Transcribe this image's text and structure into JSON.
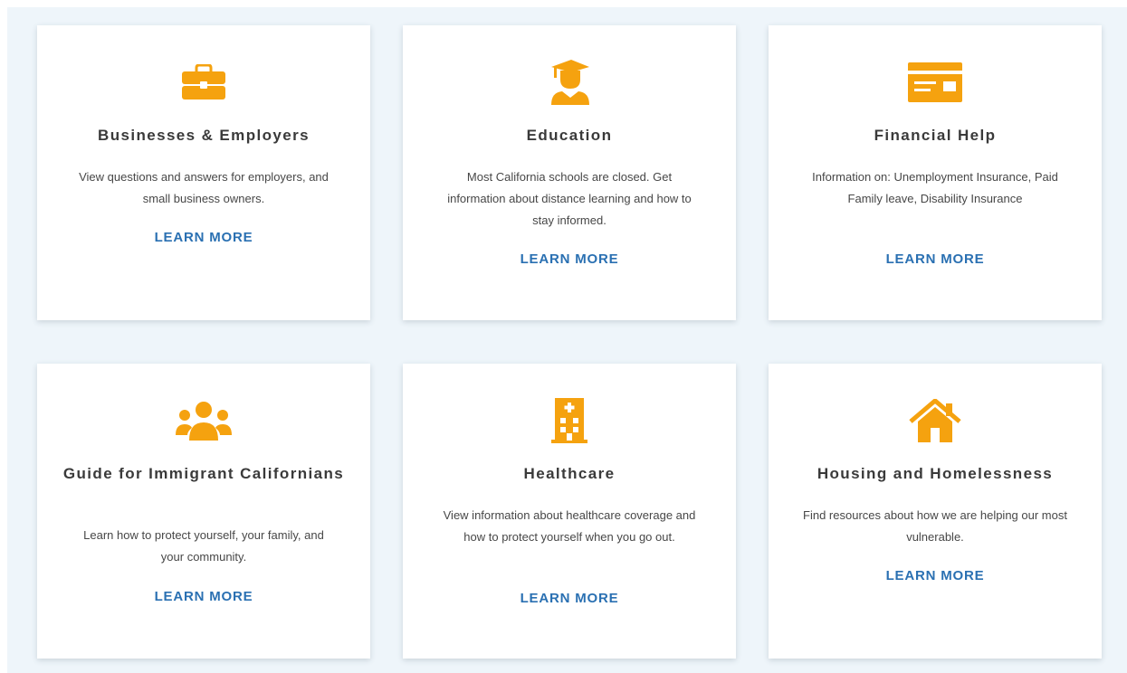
{
  "theme": {
    "accent": "#F5A20F",
    "link": "#2A70B2",
    "background": "#EEF5FA"
  },
  "cards": [
    {
      "icon": "briefcase-icon",
      "title": "Businesses & Employers",
      "description": "View questions and answers for employers, and small business owners.",
      "link": "LEARN MORE"
    },
    {
      "icon": "graduate-icon",
      "title": "Education",
      "description": "Most California schools are closed. Get information about distance learning and how to stay informed.",
      "link": "LEARN MORE"
    },
    {
      "icon": "credit-card-icon",
      "title": "Financial Help",
      "description": "Information on: Unemployment Insurance, Paid Family leave, Disability Insurance",
      "link": "LEARN MORE"
    },
    {
      "icon": "people-group-icon",
      "title": "Guide for Immigrant Californians",
      "description": "Learn how to protect yourself, your family, and your community.",
      "link": "LEARN MORE"
    },
    {
      "icon": "hospital-building-icon",
      "title": "Healthcare",
      "description": "View information about healthcare coverage and how to protect yourself when you go out.",
      "link": "LEARN MORE"
    },
    {
      "icon": "house-icon",
      "title": "Housing and Homelessness",
      "description": "Find resources about how we are helping our most vulnerable.",
      "link": "LEARN MORE"
    }
  ]
}
